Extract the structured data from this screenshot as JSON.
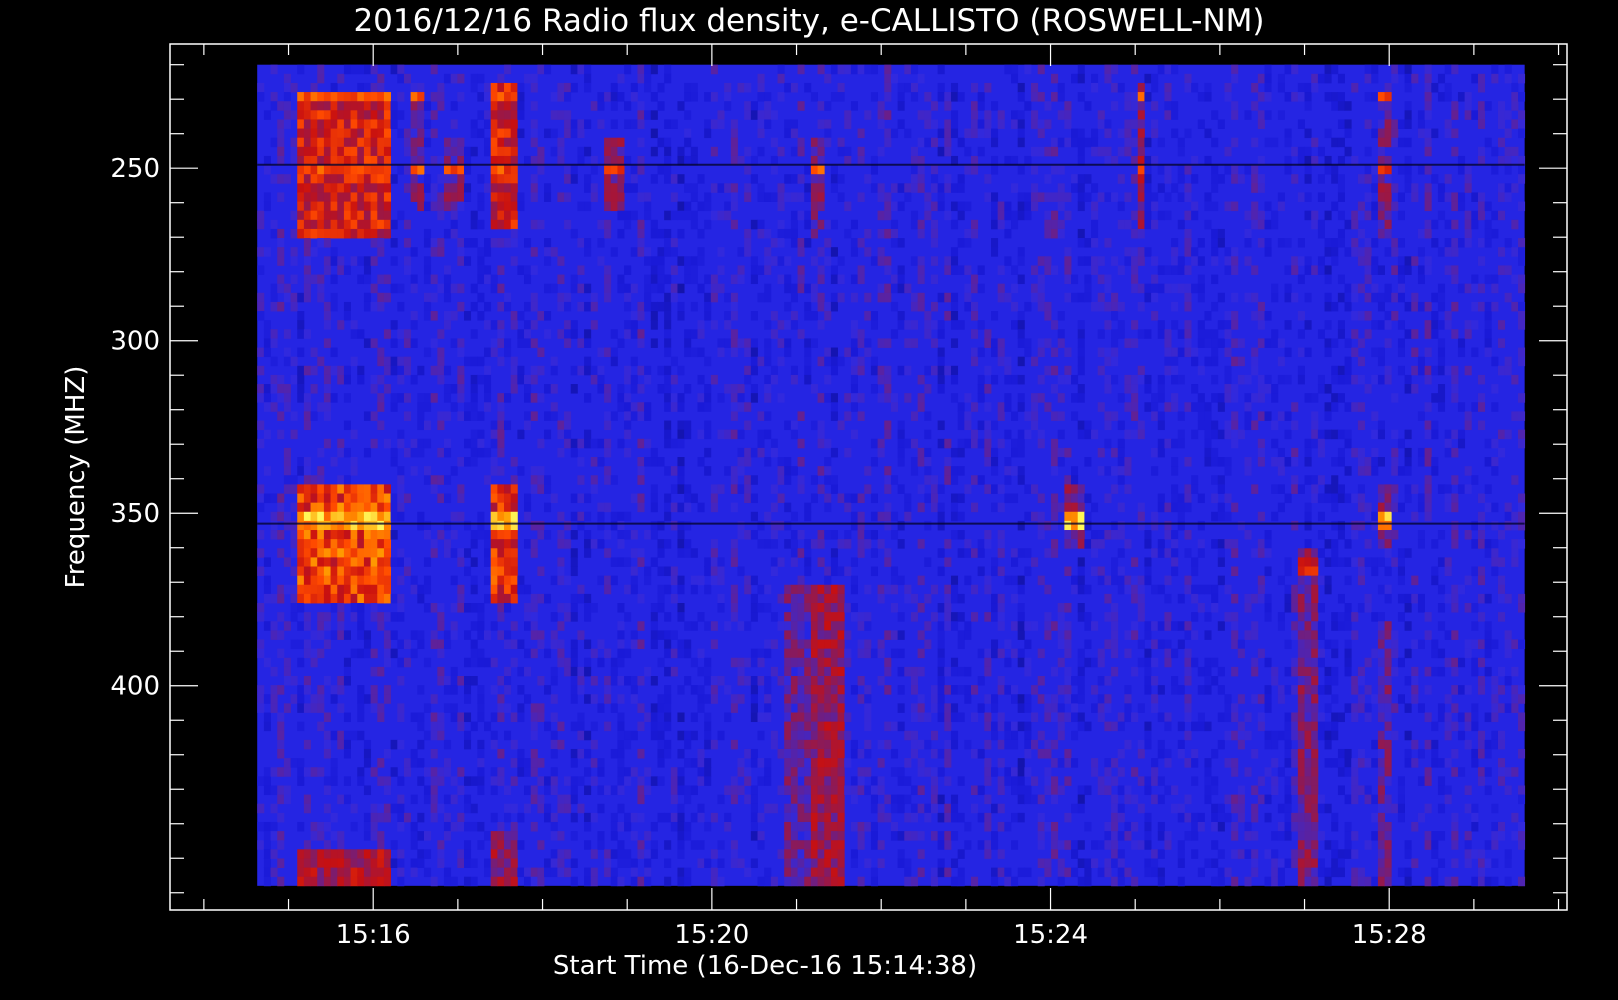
{
  "chart_data": {
    "type": "heatmap",
    "title": "2016/12/16  Radio flux density, e-CALLISTO (ROSWELL-NM)",
    "xlabel": "Start Time (16-Dec-16 15:14:38)",
    "ylabel": "Frequency (MHZ)",
    "x_axis": {
      "unit": "minutes past 15:00",
      "range": [
        13.6,
        30.1
      ],
      "data_range": [
        14.63,
        29.6
      ],
      "major_ticks": [
        16,
        20,
        24,
        28
      ],
      "tick_labels": [
        "15:16",
        "15:20",
        "15:24",
        "15:28"
      ],
      "minor_step": 1
    },
    "y_axis": {
      "unit": "MHz",
      "inverted": true,
      "range": [
        214,
        465
      ],
      "data_range": [
        220,
        458
      ],
      "major_ticks": [
        250,
        300,
        350,
        400
      ],
      "tick_labels": [
        "250",
        "300",
        "350",
        "400"
      ],
      "minor_step": 10
    },
    "colormap": [
      "#000020",
      "#1a1ad8",
      "#2a2ae8",
      "#8a1a5a",
      "#c81010",
      "#ff4a00",
      "#ffa000",
      "#ffff60"
    ],
    "background_level": 0.3,
    "bursts": [
      {
        "t_start": 15.05,
        "t_end": 16.2,
        "f_start": 226,
        "f_end": 270,
        "intensity": 0.75
      },
      {
        "t_start": 15.05,
        "t_end": 16.2,
        "f_start": 340,
        "f_end": 375,
        "intensity": 0.85
      },
      {
        "t_start": 15.05,
        "t_end": 16.2,
        "f_start": 445,
        "f_end": 458,
        "intensity": 0.65
      },
      {
        "t_start": 17.35,
        "t_end": 17.7,
        "f_start": 225,
        "f_end": 265,
        "intensity": 0.75
      },
      {
        "t_start": 17.35,
        "t_end": 17.7,
        "f_start": 340,
        "f_end": 375,
        "intensity": 0.8
      },
      {
        "t_start": 17.35,
        "t_end": 17.7,
        "f_start": 440,
        "f_end": 458,
        "intensity": 0.6
      },
      {
        "t_start": 16.4,
        "t_end": 16.55,
        "f_start": 225,
        "f_end": 262,
        "intensity": 0.5
      },
      {
        "t_start": 16.8,
        "t_end": 17.0,
        "f_start": 240,
        "f_end": 260,
        "intensity": 0.5
      },
      {
        "t_start": 18.7,
        "t_end": 18.95,
        "f_start": 240,
        "f_end": 262,
        "intensity": 0.55
      },
      {
        "t_start": 20.8,
        "t_end": 21.1,
        "f_start": 370,
        "f_end": 458,
        "intensity": 0.5
      },
      {
        "t_start": 21.1,
        "t_end": 21.5,
        "f_start": 370,
        "f_end": 458,
        "intensity": 0.62
      },
      {
        "t_start": 21.15,
        "t_end": 21.3,
        "f_start": 240,
        "f_end": 270,
        "intensity": 0.5
      },
      {
        "t_start": 25.0,
        "t_end": 25.1,
        "f_start": 225,
        "f_end": 265,
        "intensity": 0.6
      },
      {
        "t_start": 24.1,
        "t_end": 24.35,
        "f_start": 340,
        "f_end": 360,
        "intensity": 0.55
      },
      {
        "t_start": 26.9,
        "t_end": 27.1,
        "f_start": 360,
        "f_end": 458,
        "intensity": 0.55
      },
      {
        "t_start": 27.85,
        "t_end": 28.0,
        "f_start": 225,
        "f_end": 270,
        "intensity": 0.5
      },
      {
        "t_start": 27.85,
        "t_end": 28.0,
        "f_start": 340,
        "f_end": 360,
        "intensity": 0.55
      },
      {
        "t_start": 27.85,
        "t_end": 28.0,
        "f_start": 380,
        "f_end": 458,
        "intensity": 0.5
      }
    ],
    "horizontal_bands": [
      {
        "f": 228,
        "intensity": 0.8
      },
      {
        "f": 249,
        "intensity": 0.8
      },
      {
        "f": 255,
        "intensity": 0.55
      },
      {
        "f": 310,
        "intensity": 0.45
      },
      {
        "f": 350,
        "intensity": 0.95
      },
      {
        "f": 365,
        "intensity": 0.7
      }
    ],
    "dark_bands": [
      249,
      353
    ]
  }
}
